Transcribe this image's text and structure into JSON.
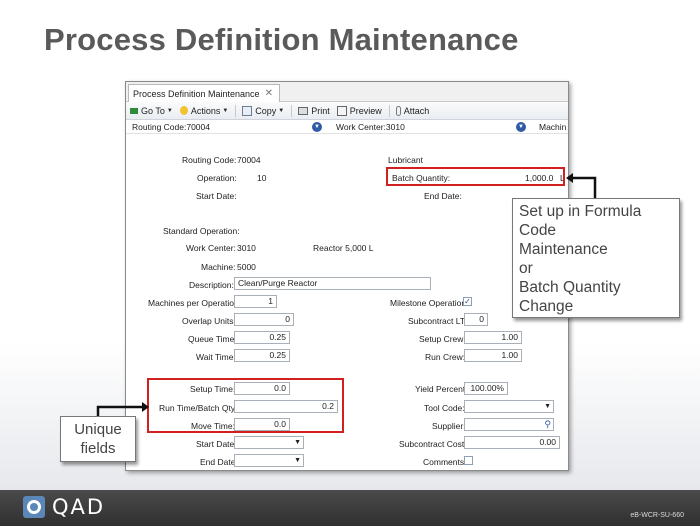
{
  "slide": {
    "title": "Process Definition Maintenance",
    "footer_brand": "QAD",
    "footer_code": "eB-WCR-SU-660"
  },
  "window": {
    "tab_title": "Process Definition Maintenance",
    "toolbar": {
      "goto": "Go To",
      "actions": "Actions",
      "copy": "Copy",
      "print": "Print",
      "preview": "Preview",
      "attach": "Attach"
    },
    "context": {
      "routing": "Routing Code:70004",
      "work_center": "Work Center:3010",
      "machine": "Machin"
    }
  },
  "form": {
    "routing_code": {
      "label": "Routing Code:",
      "value": "70004"
    },
    "operation": {
      "label": "Operation:",
      "value": "10"
    },
    "start_date_top": {
      "label": "Start Date:"
    },
    "lubricant": "Lubricant",
    "batch_quantity": {
      "label": "Batch Quantity:",
      "value": "1,000.0",
      "unit": "L"
    },
    "end_date_top": {
      "label": "End Date:"
    },
    "standard_operation": {
      "label": "Standard Operation:"
    },
    "work_center": {
      "label": "Work Center:",
      "value": "3010",
      "desc": "Reactor 5,000 L"
    },
    "machine": {
      "label": "Machine:",
      "value": "5000"
    },
    "description": {
      "label": "Description:",
      "value": "Clean/Purge Reactor"
    },
    "machines_per_op": {
      "label": "Machines per Operation:",
      "value": "1"
    },
    "milestone": {
      "label": "Milestone Operation:",
      "checked": "✓"
    },
    "overlap_units": {
      "label": "Overlap Units:",
      "value": "0"
    },
    "subcontract_lt": {
      "label": "Subcontract LT:",
      "value": "0"
    },
    "queue_time": {
      "label": "Queue Time:",
      "value": "0.25"
    },
    "setup_crew": {
      "label": "Setup Crew:",
      "value": "1.00"
    },
    "wait_time": {
      "label": "Wait Time:",
      "value": "0.25"
    },
    "run_crew": {
      "label": "Run Crew:",
      "value": "1.00"
    },
    "setup_time": {
      "label": "Setup Time:",
      "value": "0.0"
    },
    "yield_percent": {
      "label": "Yield Percent:",
      "value": "100.00%"
    },
    "run_time_batch": {
      "label": "Run Time/Batch Qty:",
      "value": "0.2"
    },
    "tool_code": {
      "label": "Tool Code:",
      "value": ""
    },
    "move_time": {
      "label": "Move Time:",
      "value": "0.0"
    },
    "supplier": {
      "label": "Supplier:",
      "value": ""
    },
    "start_date": {
      "label": "Start Date:",
      "value": ""
    },
    "subcontract_cost": {
      "label": "Subcontract Cost:",
      "value": "0.00"
    },
    "end_date": {
      "label": "End Date:",
      "value": ""
    },
    "comments": {
      "label": "Comments:"
    }
  },
  "callouts": {
    "batch": [
      "Set up in Formula",
      "Code",
      "Maintenance",
      "or",
      "Batch Quantity",
      "Change"
    ],
    "unique": [
      "Unique",
      "fields"
    ]
  },
  "colors": {
    "highlight": "#d02020",
    "footer": "#3a3a3a",
    "title": "#5a5a5a"
  }
}
